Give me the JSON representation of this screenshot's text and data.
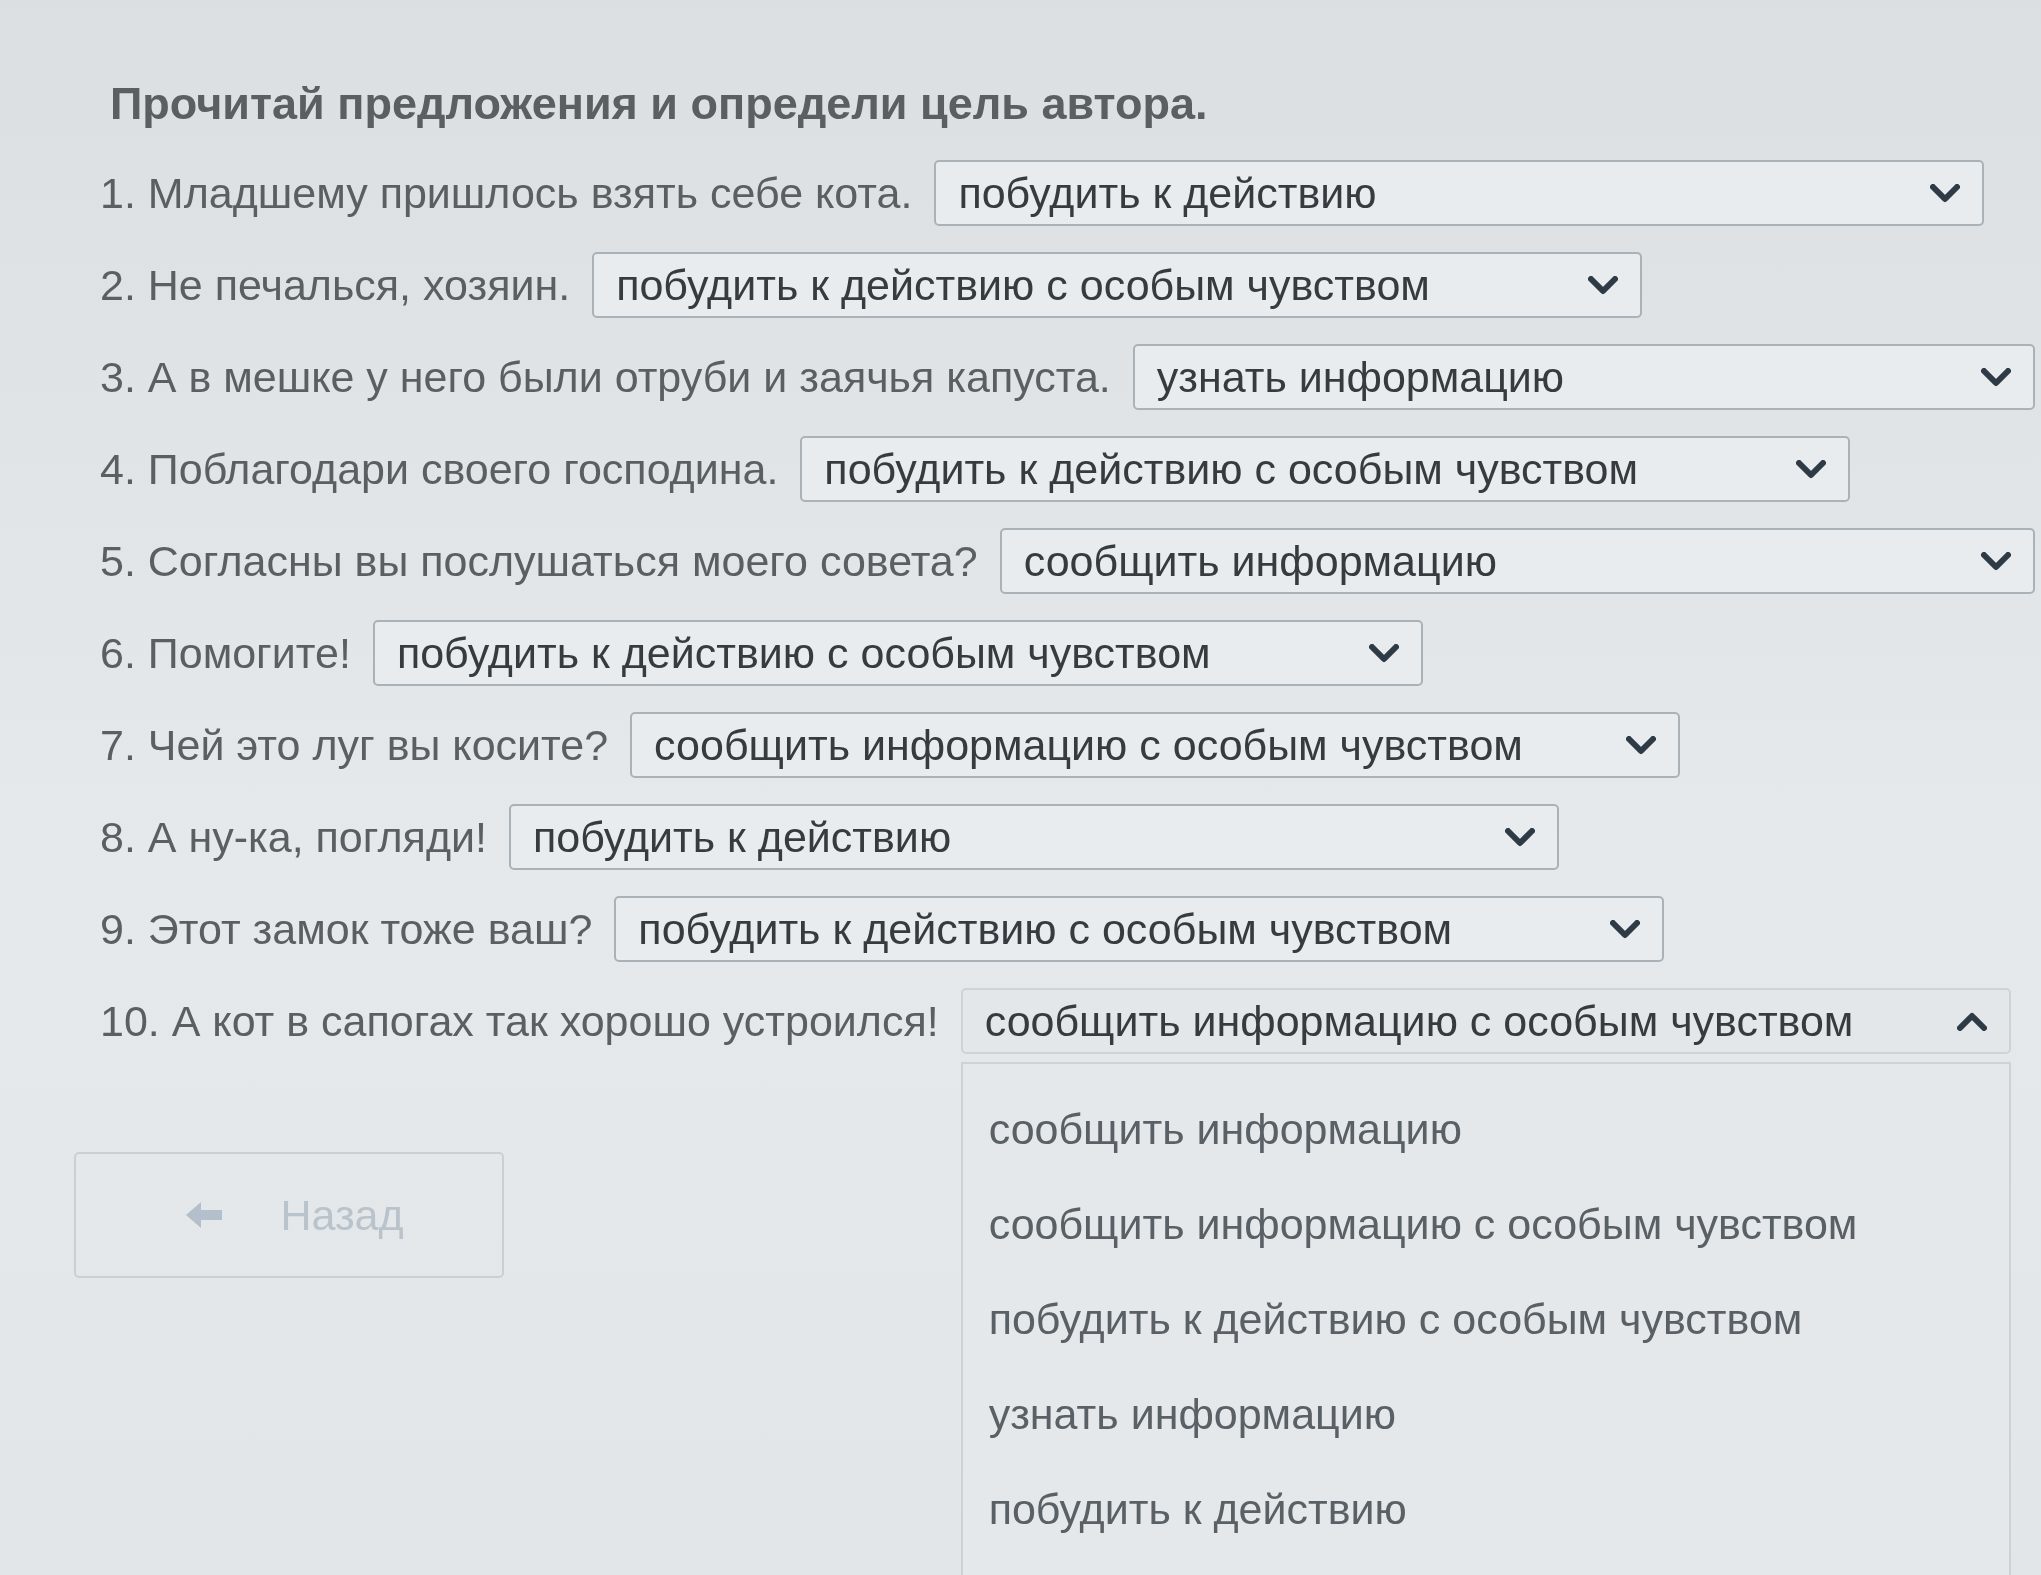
{
  "instruction": "Прочитай предложения и определи цель автора.",
  "questions": [
    {
      "sentence": "1. Младшему пришлось взять себе кота.",
      "answer": {
        "value": "побудить к действию",
        "expanded": false
      }
    },
    {
      "sentence": "2. Не печалься, хозяин.",
      "answer": {
        "value": "побудить к действию с особым чувством",
        "expanded": false
      }
    },
    {
      "sentence": "3. А в мешке у него были отруби и заячья капуста.",
      "answer": {
        "value": "узнать информацию",
        "expanded": false
      }
    },
    {
      "sentence": "4. Поблагодари своего господина.",
      "answer": {
        "value": "побудить к действию с особым чувством",
        "expanded": false
      }
    },
    {
      "sentence": "5. Согласны вы послушаться моего совета?",
      "answer": {
        "value": "сообщить информацию",
        "expanded": false
      }
    },
    {
      "sentence": "6. Помогите!",
      "answer": {
        "value": "побудить к действию с особым чувством",
        "expanded": false
      }
    },
    {
      "sentence": "7. Чей это луг вы косите?",
      "answer": {
        "value": "сообщить информацию с особым чувством",
        "expanded": false
      }
    },
    {
      "sentence": "8. А ну-ка, погляди!",
      "answer": {
        "value": "побудить к действию",
        "expanded": false
      }
    },
    {
      "sentence": "9. Этот замок тоже ваш?",
      "answer": {
        "value": "побудить к действию с особым чувством",
        "expanded": false
      }
    },
    {
      "sentence": "10. А кот в сапогах так хорошо устроился!",
      "answer": {
        "value": "сообщить информацию с особым чувством",
        "expanded": true,
        "options": [
          "сообщить информацию",
          "сообщить информацию с особым чувством",
          "побудить к действию с особым чувством",
          "узнать информацию",
          "побудить к действию"
        ]
      }
    }
  ],
  "back_button": {
    "label": "Назад",
    "disabled": true
  }
}
